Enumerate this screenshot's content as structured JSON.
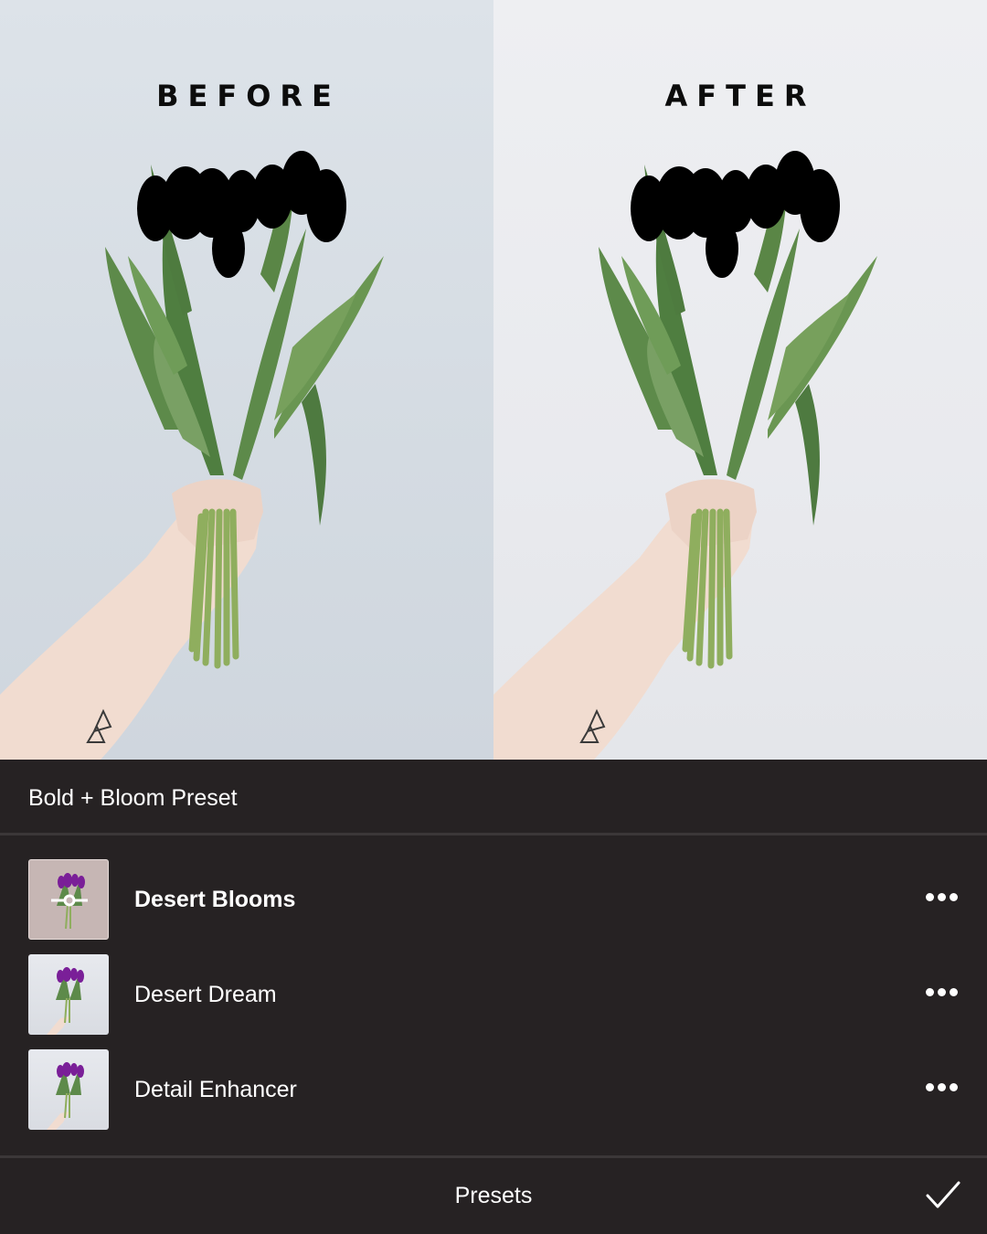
{
  "comparison": {
    "before_label": "BEFORE",
    "after_label": "AFTER"
  },
  "panel": {
    "title": "Bold + Bloom Preset",
    "presets": [
      {
        "name": "Desert Blooms",
        "selected": true
      },
      {
        "name": "Desert Dream",
        "selected": false
      },
      {
        "name": "Detail Enhancer",
        "selected": false
      }
    ]
  },
  "footer": {
    "label": "Presets",
    "confirm_icon": "checkmark-icon"
  },
  "colors": {
    "panel_bg": "#262223",
    "text": "#ffffff",
    "tulip_before": "#6d1f8a",
    "tulip_after": "#7e1a9e",
    "leaf": "#5f8a4a"
  }
}
